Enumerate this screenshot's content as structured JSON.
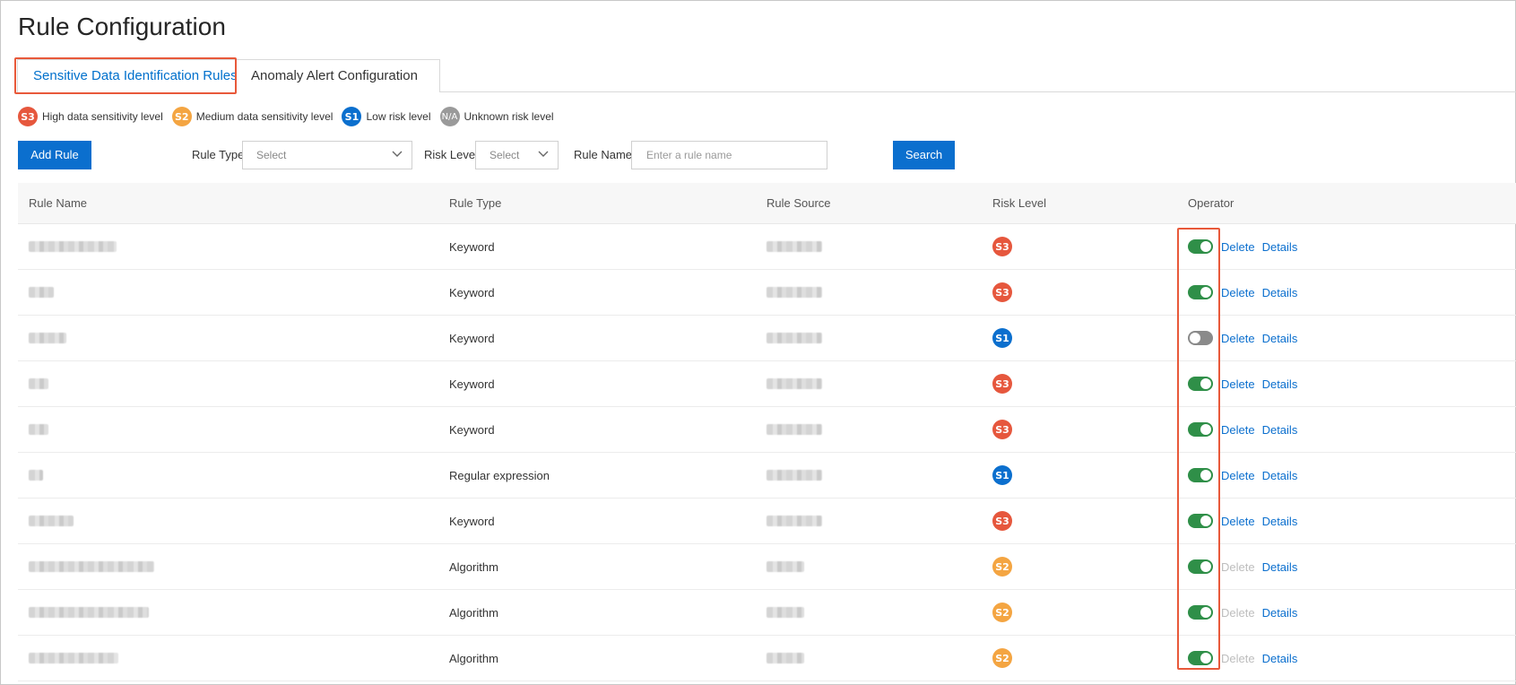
{
  "page": {
    "title": "Rule Configuration"
  },
  "tabs": [
    {
      "label": "Sensitive Data Identification Rules",
      "active": true
    },
    {
      "label": "Anomaly Alert Configuration",
      "active": false
    }
  ],
  "legend": [
    {
      "badge": "S3",
      "label": "High data sensitivity level",
      "color": "#e6573d"
    },
    {
      "badge": "S2",
      "label": "Medium data sensitivity level",
      "color": "#f4a542"
    },
    {
      "badge": "S1",
      "label": "Low risk level",
      "color": "#0b6fce"
    },
    {
      "badge": "N/A",
      "label": "Unknown risk level",
      "color": "#9a9a9a"
    }
  ],
  "toolbar": {
    "add_label": "Add Rule",
    "rule_type_label": "Rule Type",
    "rule_type_value": "Select",
    "risk_level_label": "Risk Level",
    "risk_level_value": "Select",
    "rule_name_label": "Rule Name",
    "rule_name_placeholder": "Enter a rule name",
    "search_label": "Search"
  },
  "table": {
    "columns": [
      "Rule Name",
      "Rule Type",
      "Rule Source",
      "Risk Level",
      "Operator"
    ],
    "actions": {
      "delete": "Delete",
      "details": "Details"
    },
    "rows": [
      {
        "type": "Keyword",
        "risk": "S3",
        "enabled": true,
        "deletable": true
      },
      {
        "type": "Keyword",
        "risk": "S3",
        "enabled": true,
        "deletable": true
      },
      {
        "type": "Keyword",
        "risk": "S1",
        "enabled": false,
        "deletable": true
      },
      {
        "type": "Keyword",
        "risk": "S3",
        "enabled": true,
        "deletable": true
      },
      {
        "type": "Keyword",
        "risk": "S3",
        "enabled": true,
        "deletable": true
      },
      {
        "type": "Regular expression",
        "risk": "S1",
        "enabled": true,
        "deletable": true
      },
      {
        "type": "Keyword",
        "risk": "S3",
        "enabled": true,
        "deletable": true
      },
      {
        "type": "Algorithm",
        "risk": "S2",
        "enabled": true,
        "deletable": false
      },
      {
        "type": "Algorithm",
        "risk": "S2",
        "enabled": true,
        "deletable": false
      },
      {
        "type": "Algorithm",
        "risk": "S2",
        "enabled": true,
        "deletable": false
      }
    ]
  },
  "colors": {
    "accent": "#0b6fce",
    "highlight": "#e8593a",
    "toggle_on": "#2f8f48",
    "toggle_off": "#8a8a8a"
  }
}
